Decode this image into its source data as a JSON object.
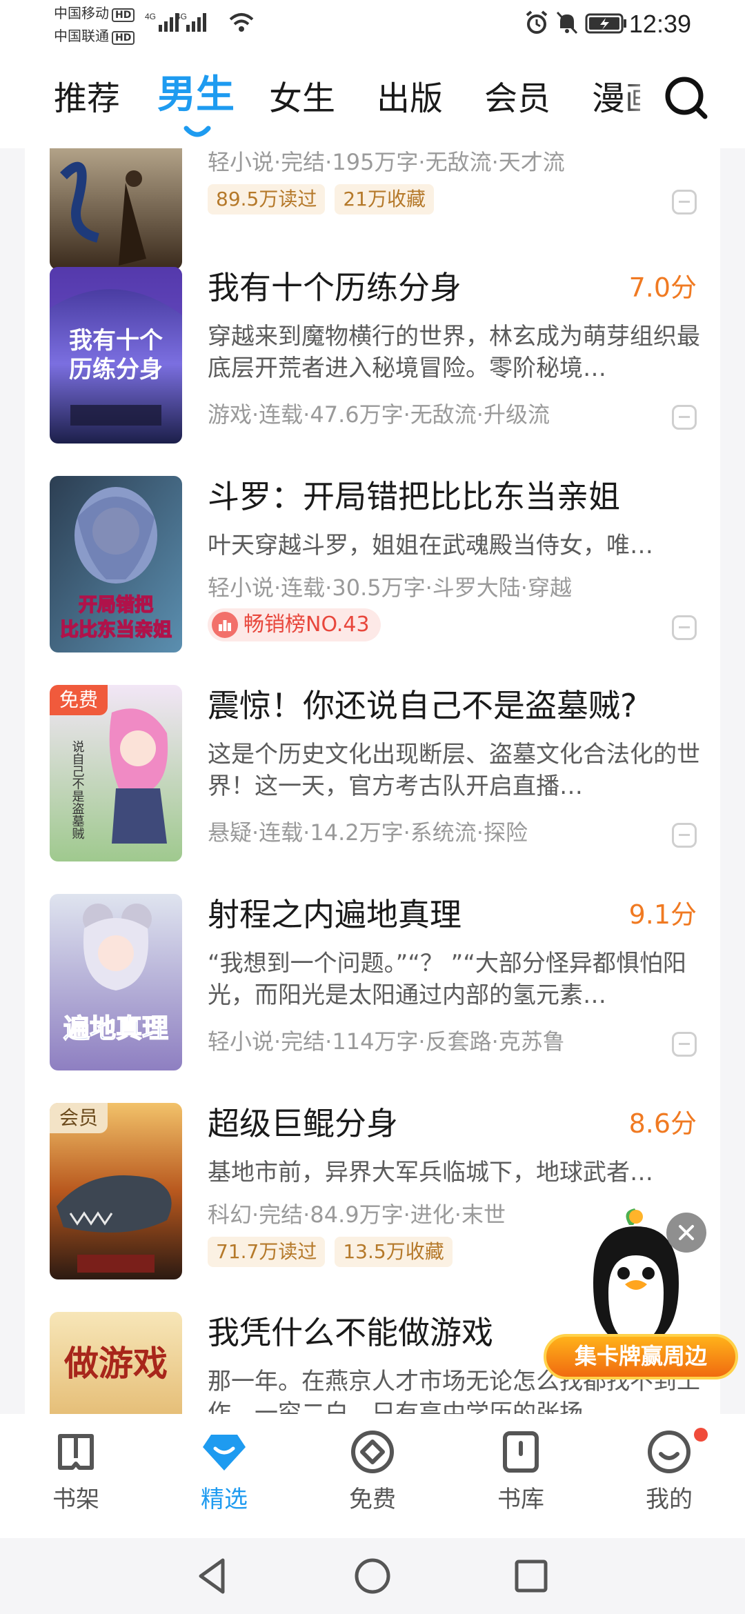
{
  "status_bar": {
    "carrier_1": "中国移动",
    "carrier_2": "中国联通",
    "hd_badge": "HD",
    "network": "4G",
    "time": "12:39"
  },
  "top_tabs": [
    {
      "label": "推荐",
      "active": false
    },
    {
      "label": "男生",
      "active": true
    },
    {
      "label": "女生",
      "active": false
    },
    {
      "label": "出版",
      "active": false
    },
    {
      "label": "会员",
      "active": false
    },
    {
      "label": "漫画",
      "active": false
    }
  ],
  "books": [
    {
      "meta": "轻小说·完结·195万字·无敌流·天才流",
      "tags": [
        "89.5万读过",
        "21万收藏"
      ]
    },
    {
      "title": "我有十个历练分身",
      "score": "7.0分",
      "desc": "穿越来到魔物横行的世界，林玄成为萌芽组织最底层开荒者进入秘境冒险。零阶秘境…",
      "meta": "游戏·连载·47.6万字·无敌流·升级流",
      "cover_text": "我有十个历练分身"
    },
    {
      "title": "斗罗：开局错把比比东当亲姐",
      "desc": "叶天穿越斗罗，姐姐在武魂殿当侍女，唯…",
      "meta": "轻小说·连载·30.5万字·斗罗大陆·穿越",
      "rank": "畅销榜NO.43",
      "cover_text": "开局错把比比东当亲姐"
    },
    {
      "title": "震惊！你还说自己不是盗墓贼?",
      "badge": "免费",
      "desc": "这是个历史文化出现断层、盗墓文化合法化的世界！这一天，官方考古队开启直播…",
      "meta": "悬疑·连载·14.2万字·系统流·探险"
    },
    {
      "title": "射程之内遍地真理",
      "score": "9.1分",
      "desc": "“我想到一个问题。”“？ ”“大部分怪异都惧怕阳光，而阳光是太阳通过内部的氢元素…",
      "meta": "轻小说·完结·114万字·反套路·克苏鲁",
      "cover_text": "遍地真理"
    },
    {
      "title": "超级巨鲲分身",
      "score": "8.6分",
      "badge": "会员",
      "desc": "基地市前，异界大军兵临城下，地球武者…",
      "meta": "科幻·完结·84.9万字·进化·末世",
      "tags": [
        "71.7万读过",
        "13.5万收藏"
      ]
    },
    {
      "title": "我凭什么不能做游戏",
      "desc": "那一年。在燕京人才市场无论怎么找都找不到工作，一穷二白，只有高中学历的张扬…",
      "cover_text": "做游戏"
    }
  ],
  "promo": {
    "label": "集卡牌赢周边"
  },
  "bottom_nav": [
    {
      "label": "书架",
      "icon": "bookshelf-icon"
    },
    {
      "label": "精选",
      "icon": "featured-icon",
      "active": true
    },
    {
      "label": "免费",
      "icon": "free-icon"
    },
    {
      "label": "书库",
      "icon": "library-icon"
    },
    {
      "label": "我的",
      "icon": "profile-icon"
    }
  ],
  "colors": {
    "accent": "#1e9bf0",
    "score": "#f07a22",
    "tag_text": "#b5792a",
    "rank_text": "#e8473c"
  }
}
